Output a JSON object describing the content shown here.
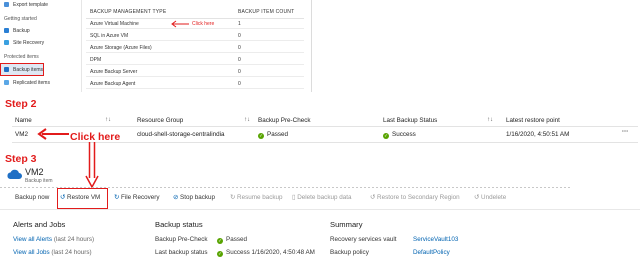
{
  "sidebar": {
    "items_top": [
      {
        "label": "Export template"
      }
    ],
    "getting_started": {
      "heading": "Getting started",
      "items": [
        {
          "label": "Backup"
        },
        {
          "label": "Site Recovery"
        }
      ]
    },
    "protected_items": {
      "heading": "Protected items",
      "items": [
        {
          "label": "Backup items"
        },
        {
          "label": "Replicated items"
        }
      ]
    }
  },
  "backup_management": {
    "col_type": "BACKUP MANAGEMENT TYPE",
    "col_count": "BACKUP ITEM COUNT",
    "rows": [
      {
        "type": "Azure Virtual Machine",
        "count": "1"
      },
      {
        "type": "SQL in Azure VM",
        "count": "0"
      },
      {
        "type": "Azure Storage (Azure Files)",
        "count": "0"
      },
      {
        "type": "DPM",
        "count": "0"
      },
      {
        "type": "Azure Backup Server",
        "count": "0"
      },
      {
        "type": "Azure Backup Agent",
        "count": "0"
      }
    ],
    "click_here": "Click here"
  },
  "steps": {
    "step2": "Step 2",
    "step3": "Step 3",
    "click_here": "Click here"
  },
  "grid": {
    "headers": {
      "name": "Name",
      "resource_group": "Resource Group",
      "precheck": "Backup Pre-Check",
      "last_status": "Last Backup Status",
      "latest_restore": "Latest restore point"
    },
    "row": {
      "name": "VM2",
      "resource_group": "cloud-shell-storage-centralindia",
      "precheck": "Passed",
      "last_status": "Success",
      "latest_restore": "1/16/2020, 4:50:51 AM",
      "more": "···"
    }
  },
  "vm_header": {
    "title": "VM2",
    "subtitle": "Backup item"
  },
  "toolbar": {
    "backup_now": "Backup now",
    "restore_vm": "Restore VM",
    "file_recovery": "File Recovery",
    "stop_backup": "Stop backup",
    "resume_backup": "Resume backup",
    "delete_backup_data": "Delete backup data",
    "restore_secondary": "Restore to Secondary Region",
    "undelete": "Undelete"
  },
  "alerts": {
    "title": "Alerts and Jobs",
    "view_alerts": "View all Alerts",
    "view_alerts_suffix": "(last 24 hours)",
    "view_jobs": "View all Jobs",
    "view_jobs_suffix": "(last 24 hours)"
  },
  "backup_status": {
    "title": "Backup status",
    "precheck_label": "Backup Pre-Check",
    "precheck_value": "Passed",
    "last_status_label": "Last backup status",
    "last_status_value": "Success 1/16/2020, 4:50:48 AM"
  },
  "summary": {
    "title": "Summary",
    "vault_label": "Recovery services vault",
    "vault_value": "ServiceVault103",
    "policy_label": "Backup policy",
    "policy_value": "DefaultPolicy"
  },
  "colors": {
    "annotation_red": "#e21b1b",
    "link_blue": "#0063b1",
    "success_green": "#57a300"
  }
}
